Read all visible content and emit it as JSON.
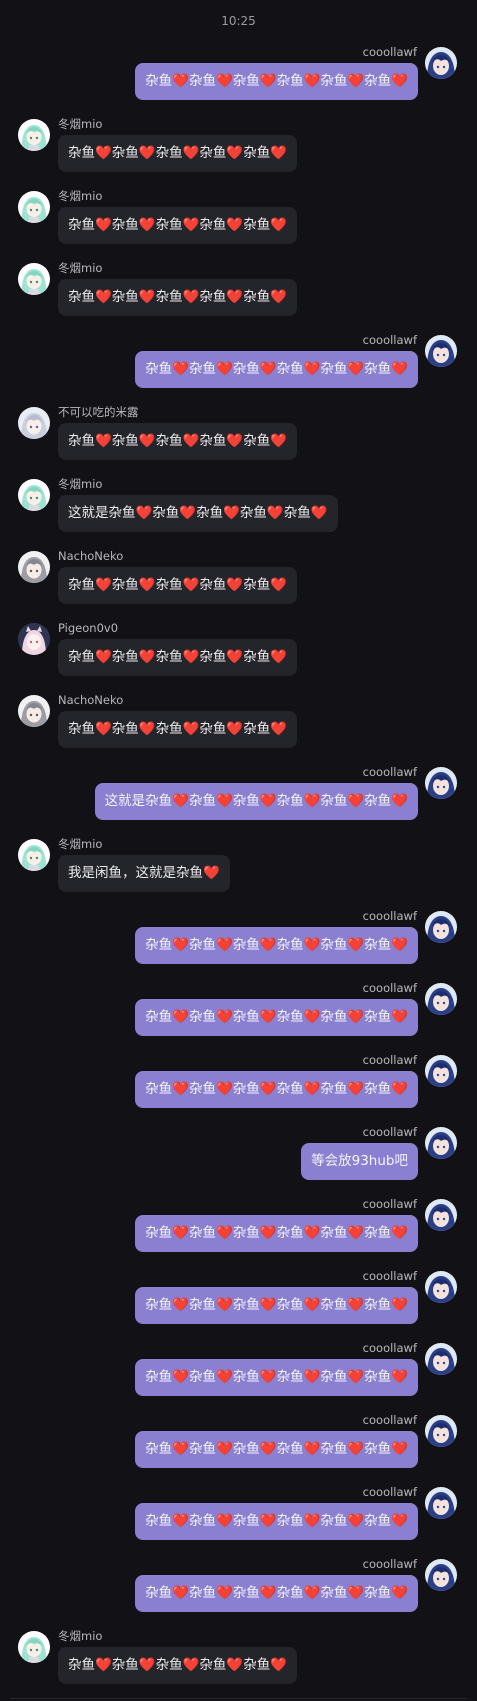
{
  "timestamp": "10:25",
  "messages": [
    {
      "side": "out",
      "name": "cooollawf",
      "text": "杂鱼❤️杂鱼❤️杂鱼❤️杂鱼❤️杂鱼❤️杂鱼❤️",
      "avatar": "blue-hair-avatar"
    },
    {
      "side": "in",
      "name": "冬烟mio",
      "text": "杂鱼❤️杂鱼❤️杂鱼❤️杂鱼❤️杂鱼❤️",
      "avatar": "mint-hair-avatar"
    },
    {
      "side": "in",
      "name": "冬烟mio",
      "text": "杂鱼❤️杂鱼❤️杂鱼❤️杂鱼❤️杂鱼❤️",
      "avatar": "mint-hair-avatar"
    },
    {
      "side": "in",
      "name": "冬烟mio",
      "text": "杂鱼❤️杂鱼❤️杂鱼❤️杂鱼❤️杂鱼❤️",
      "avatar": "mint-hair-avatar"
    },
    {
      "side": "out",
      "name": "cooollawf",
      "text": "杂鱼❤️杂鱼❤️杂鱼❤️杂鱼❤️杂鱼❤️杂鱼❤️",
      "avatar": "blue-hair-avatar"
    },
    {
      "side": "in",
      "name": "不可以吃的米露",
      "text": "杂鱼❤️杂鱼❤️杂鱼❤️杂鱼❤️杂鱼❤️",
      "avatar": "silver-hair-avatar"
    },
    {
      "side": "in",
      "name": "冬烟mio",
      "text": "这就是杂鱼❤️杂鱼❤️杂鱼❤️杂鱼❤️杂鱼❤️",
      "avatar": "mint-hair-avatar"
    },
    {
      "side": "in",
      "name": "NachoNeko",
      "text": "杂鱼❤️杂鱼❤️杂鱼❤️杂鱼❤️杂鱼❤️",
      "avatar": "grey-hair-avatar"
    },
    {
      "side": "in",
      "name": "Pigeon0v0",
      "text": "杂鱼❤️杂鱼❤️杂鱼❤️杂鱼❤️杂鱼❤️",
      "avatar": "pink-hair-avatar"
    },
    {
      "side": "in",
      "name": "NachoNeko",
      "text": "杂鱼❤️杂鱼❤️杂鱼❤️杂鱼❤️杂鱼❤️",
      "avatar": "grey-hair-avatar"
    },
    {
      "side": "out",
      "name": "cooollawf",
      "text": "这就是杂鱼❤️杂鱼❤️杂鱼❤️杂鱼❤️杂鱼❤️杂鱼❤️",
      "avatar": "blue-hair-avatar"
    },
    {
      "side": "in",
      "name": "冬烟mio",
      "text": "我是闲鱼，这就是杂鱼❤️",
      "avatar": "mint-hair-avatar"
    },
    {
      "side": "out",
      "name": "cooollawf",
      "text": "杂鱼❤️杂鱼❤️杂鱼❤️杂鱼❤️杂鱼❤️杂鱼❤️",
      "avatar": "blue-hair-avatar"
    },
    {
      "side": "out",
      "name": "cooollawf",
      "text": "杂鱼❤️杂鱼❤️杂鱼❤️杂鱼❤️杂鱼❤️杂鱼❤️",
      "avatar": "blue-hair-avatar"
    },
    {
      "side": "out",
      "name": "cooollawf",
      "text": "杂鱼❤️杂鱼❤️杂鱼❤️杂鱼❤️杂鱼❤️杂鱼❤️",
      "avatar": "blue-hair-avatar"
    },
    {
      "side": "out",
      "name": "cooollawf",
      "text": "等会放93hub吧",
      "avatar": "blue-hair-avatar"
    },
    {
      "side": "out",
      "name": "cooollawf",
      "text": "杂鱼❤️杂鱼❤️杂鱼❤️杂鱼❤️杂鱼❤️杂鱼❤️",
      "avatar": "blue-hair-avatar"
    },
    {
      "side": "out",
      "name": "cooollawf",
      "text": "杂鱼❤️杂鱼❤️杂鱼❤️杂鱼❤️杂鱼❤️杂鱼❤️",
      "avatar": "blue-hair-avatar"
    },
    {
      "side": "out",
      "name": "cooollawf",
      "text": "杂鱼❤️杂鱼❤️杂鱼❤️杂鱼❤️杂鱼❤️杂鱼❤️",
      "avatar": "blue-hair-avatar"
    },
    {
      "side": "out",
      "name": "cooollawf",
      "text": "杂鱼❤️杂鱼❤️杂鱼❤️杂鱼❤️杂鱼❤️杂鱼❤️",
      "avatar": "blue-hair-avatar"
    },
    {
      "side": "out",
      "name": "cooollawf",
      "text": "杂鱼❤️杂鱼❤️杂鱼❤️杂鱼❤️杂鱼❤️杂鱼❤️",
      "avatar": "blue-hair-avatar"
    },
    {
      "side": "out",
      "name": "cooollawf",
      "text": "杂鱼❤️杂鱼❤️杂鱼❤️杂鱼❤️杂鱼❤️杂鱼❤️",
      "avatar": "blue-hair-avatar"
    },
    {
      "side": "in",
      "name": "冬烟mio",
      "text": "杂鱼❤️杂鱼❤️杂鱼❤️杂鱼❤️杂鱼❤️",
      "avatar": "mint-hair-avatar"
    }
  ],
  "colors": {
    "background": "#111116",
    "outgoing_bubble": "#8a7fd0",
    "incoming_bubble": "#24242b",
    "name_text": "#b8b8bd",
    "timestamp_text": "#9a9aa0"
  }
}
